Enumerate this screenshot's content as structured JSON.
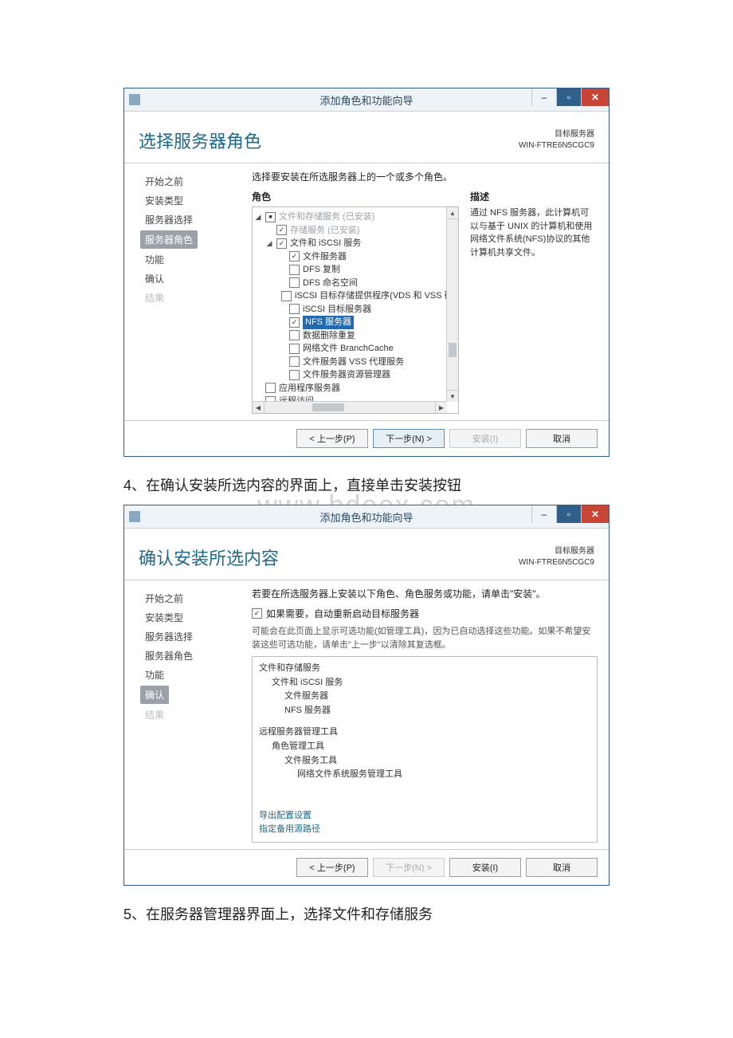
{
  "steps": {
    "step4": "4、在确认安装所选内容的界面上，直接单击安装按钮",
    "step5": "5、在服务器管理器界面上，选择文件和存储服务"
  },
  "watermark": "www.bdoex.com",
  "win1": {
    "title": "添加角色和功能向导",
    "page_title": "选择服务器角色",
    "dest_label": "目标服务器",
    "dest_value": "WIN-FTRE6N5CGC9",
    "sidebar": [
      {
        "label": "开始之前",
        "sel": false,
        "dim": false
      },
      {
        "label": "安装类型",
        "sel": false,
        "dim": false
      },
      {
        "label": "服务器选择",
        "sel": false,
        "dim": false
      },
      {
        "label": "服务器角色",
        "sel": true,
        "dim": false
      },
      {
        "label": "功能",
        "sel": false,
        "dim": false
      },
      {
        "label": "确认",
        "sel": false,
        "dim": false
      },
      {
        "label": "结果",
        "sel": false,
        "dim": true
      }
    ],
    "instruction": "选择要安装在所选服务器上的一个或多个角色。",
    "roles_label": "角色",
    "desc_label": "描述",
    "tree": [
      {
        "indent": 0,
        "exp": "◢",
        "cb": "mix",
        "label": "文件和存储服务 (已安装)",
        "inst": true,
        "sel": false
      },
      {
        "indent": 1,
        "exp": "",
        "cb": "chk",
        "label": "存储服务 (已安装)",
        "inst": true,
        "sel": false
      },
      {
        "indent": 1,
        "exp": "◢",
        "cb": "chk",
        "label": "文件和 iSCSI 服务",
        "inst": false,
        "sel": false
      },
      {
        "indent": 2,
        "exp": "",
        "cb": "chk",
        "label": "文件服务器",
        "inst": false,
        "sel": false
      },
      {
        "indent": 2,
        "exp": "",
        "cb": "",
        "label": "DFS 复制",
        "inst": false,
        "sel": false
      },
      {
        "indent": 2,
        "exp": "",
        "cb": "",
        "label": "DFS 命名空间",
        "inst": false,
        "sel": false
      },
      {
        "indent": 2,
        "exp": "",
        "cb": "",
        "label": "iSCSI 目标存储提供程序(VDS 和 VSS 硬件)",
        "inst": false,
        "sel": false
      },
      {
        "indent": 2,
        "exp": "",
        "cb": "",
        "label": "iSCSI 目标服务器",
        "inst": false,
        "sel": false
      },
      {
        "indent": 2,
        "exp": "",
        "cb": "chk",
        "label": "NFS 服务器",
        "inst": false,
        "sel": true
      },
      {
        "indent": 2,
        "exp": "",
        "cb": "",
        "label": "数据删除重复",
        "inst": false,
        "sel": false
      },
      {
        "indent": 2,
        "exp": "",
        "cb": "",
        "label": "网络文件 BranchCache",
        "inst": false,
        "sel": false
      },
      {
        "indent": 2,
        "exp": "",
        "cb": "",
        "label": "文件服务器 VSS 代理服务",
        "inst": false,
        "sel": false
      },
      {
        "indent": 2,
        "exp": "",
        "cb": "",
        "label": "文件服务器资源管理器",
        "inst": false,
        "sel": false
      },
      {
        "indent": 0,
        "exp": "",
        "cb": "",
        "label": "应用程序服务器",
        "inst": false,
        "sel": false
      },
      {
        "indent": 0,
        "exp": "",
        "cb": "",
        "label": "远程访问",
        "inst": false,
        "sel": false
      }
    ],
    "description": "通过 NFS 服务器，此计算机可以与基于 UNIX 的计算机和使用网络文件系统(NFS)协议的其他计算机共享文件。",
    "buttons": {
      "prev": "< 上一步(P)",
      "next": "下一步(N) >",
      "install": "安装(I)",
      "cancel": "取消"
    }
  },
  "win2": {
    "title": "添加角色和功能向导",
    "page_title": "确认安装所选内容",
    "dest_label": "目标服务器",
    "dest_value": "WIN-FTRE6N5CGC9",
    "sidebar": [
      {
        "label": "开始之前",
        "sel": false,
        "dim": false
      },
      {
        "label": "安装类型",
        "sel": false,
        "dim": false
      },
      {
        "label": "服务器选择",
        "sel": false,
        "dim": false
      },
      {
        "label": "服务器角色",
        "sel": false,
        "dim": false
      },
      {
        "label": "功能",
        "sel": false,
        "dim": false
      },
      {
        "label": "确认",
        "sel": true,
        "dim": false
      },
      {
        "label": "结果",
        "sel": false,
        "dim": true
      }
    ],
    "instruction": "若要在所选服务器上安装以下角色、角色服务或功能，请单击\"安装\"。",
    "restart_label": "如果需要，自动重新启动目标服务器",
    "note": "可能会在此页面上显示可选功能(如管理工具)，因为已自动选择这些功能。如果不希望安装这些可选功能，请单击\"上一步\"以清除其复选框。",
    "list": [
      {
        "indent": 1,
        "text": "文件和存储服务"
      },
      {
        "indent": 2,
        "text": "文件和 iSCSI 服务"
      },
      {
        "indent": 3,
        "text": "文件服务器"
      },
      {
        "indent": 3,
        "text": "NFS 服务器"
      },
      {
        "indent": 1,
        "text": "远程服务器管理工具",
        "gap": true
      },
      {
        "indent": 2,
        "text": "角色管理工具"
      },
      {
        "indent": 3,
        "text": "文件服务工具"
      },
      {
        "indent": 4,
        "text": "网络文件系统服务管理工具"
      }
    ],
    "link1": "导出配置设置",
    "link2": "指定备用源路径",
    "buttons": {
      "prev": "< 上一步(P)",
      "next": "下一步(N) >",
      "install": "安装(I)",
      "cancel": "取消"
    }
  }
}
